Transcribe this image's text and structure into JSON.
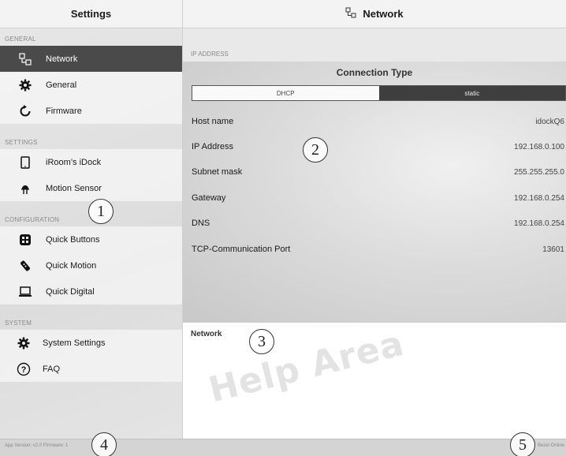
{
  "sidebar": {
    "title": "Settings",
    "sections": [
      {
        "label": "GENERAL",
        "items": [
          {
            "label": "Network",
            "icon": "network-icon"
          },
          {
            "label": "General",
            "icon": "gear-icon"
          },
          {
            "label": "Firmware",
            "icon": "refresh-icon"
          }
        ]
      },
      {
        "label": "SETTINGS",
        "items": [
          {
            "label": "iRoom’s iDock",
            "icon": "tablet-icon"
          },
          {
            "label": "Motion Sensor",
            "icon": "motion-sensor-icon"
          }
        ]
      },
      {
        "label": "CONFIGURATION",
        "items": [
          {
            "label": "Quick Buttons",
            "icon": "button-grid-icon"
          },
          {
            "label": "Quick Motion",
            "icon": "remote-icon"
          },
          {
            "label": "Quick Digital",
            "icon": "laptop-icon"
          }
        ]
      },
      {
        "label": "SYSTEM",
        "items": [
          {
            "label": "System Settings",
            "icon": "gear-icon"
          },
          {
            "label": "FAQ",
            "icon": "question-icon"
          }
        ]
      }
    ]
  },
  "header": {
    "title": "Network",
    "icon": "network-icon"
  },
  "network": {
    "section_label": "IP ADDRESS",
    "connection_type_title": "Connection Type",
    "options": [
      "DHCP",
      "static"
    ],
    "selected": "static",
    "fields": [
      {
        "label": "Host name",
        "value": "idockQ6"
      },
      {
        "label": "IP Address",
        "value": "192.168.0.100"
      },
      {
        "label": "Subnet mask",
        "value": "255.255.255.0"
      },
      {
        "label": "Gateway",
        "value": "192.168.0.254"
      },
      {
        "label": "DNS",
        "value": "192.168.0.254"
      },
      {
        "label": "TCP-Communication Port",
        "value": "13601"
      }
    ]
  },
  "help": {
    "title": "Network",
    "watermark": "Help Area"
  },
  "footer": {
    "left": "App Version: v2.0 Firmware: 1",
    "right": "Bezel Online"
  },
  "callouts": [
    "1",
    "2",
    "3",
    "4",
    "5"
  ],
  "colors": {
    "active_item_bg": "#4a4a4a",
    "segment_selected_bg": "#3f3f3f"
  }
}
